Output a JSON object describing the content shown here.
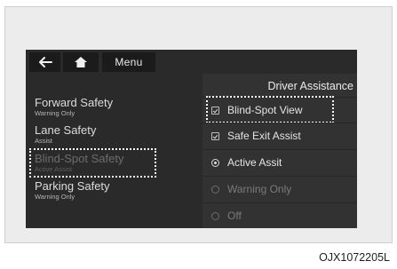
{
  "topbar": {
    "back_icon": "arrow-left-icon",
    "home_icon": "home-icon",
    "menu_label": "Menu"
  },
  "categories": [
    {
      "title": "Forward Safety",
      "subtitle": "Warning Only",
      "state": "normal"
    },
    {
      "title": "Lane Safety",
      "subtitle": "Assist",
      "state": "normal"
    },
    {
      "title": "Blind-Spot Safety",
      "subtitle": "Active Assist",
      "state": "selected-dimmed"
    },
    {
      "title": "Parking Safety",
      "subtitle": "Warning Only",
      "state": "normal"
    }
  ],
  "right_panel": {
    "title": "Driver Assistance",
    "options": [
      {
        "label": "Blind-Spot View",
        "control": "checkbox",
        "checked": true
      },
      {
        "label": "Safe Exit Assist",
        "control": "checkbox",
        "checked": true
      },
      {
        "label": "Active Assit",
        "control": "radio",
        "checked": true
      },
      {
        "label": "Warning Only",
        "control": "radio",
        "checked": false
      },
      {
        "label": "Off",
        "control": "radio",
        "checked": false
      }
    ]
  },
  "caption_code": "OJX1072205L",
  "colors": {
    "screen_bg": "#2a2a2a",
    "panel_bg": "#323232",
    "highlight": "#ffffff"
  }
}
